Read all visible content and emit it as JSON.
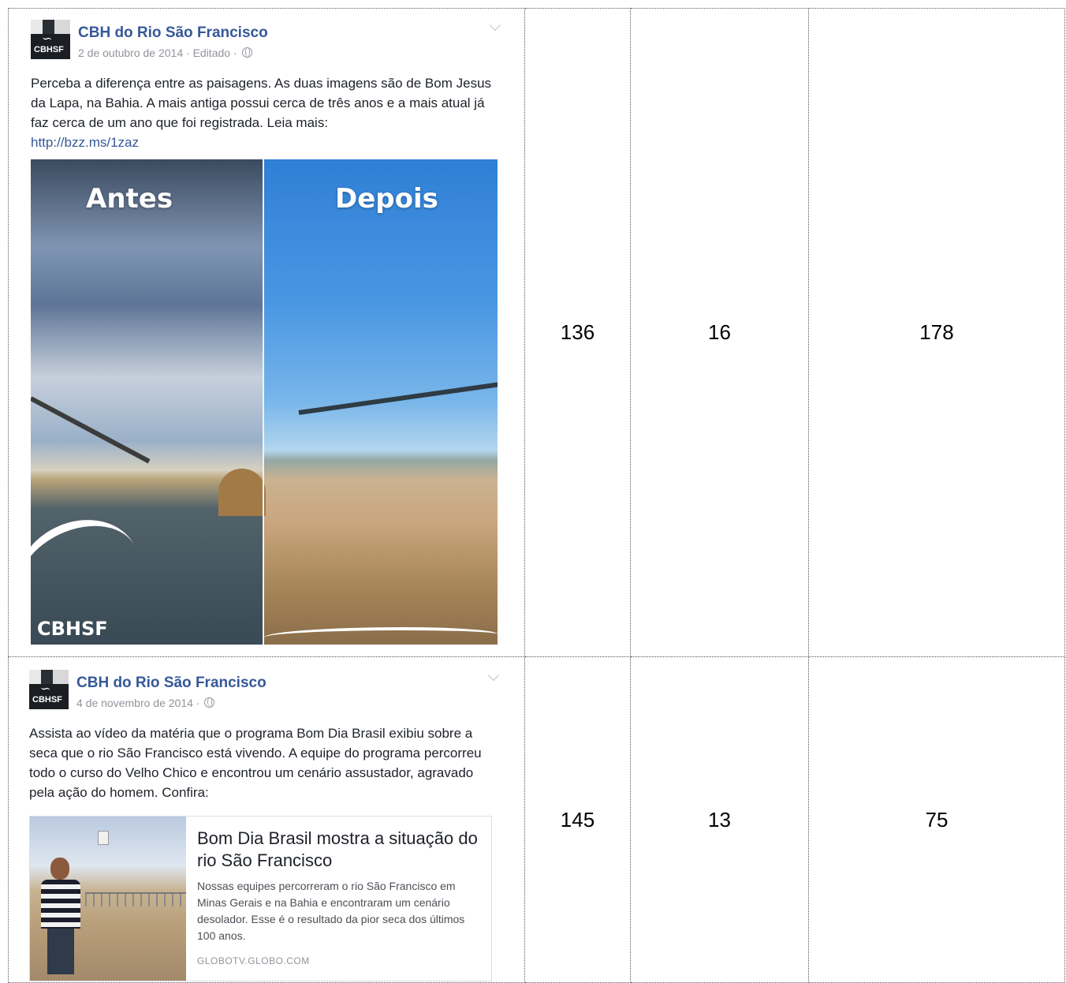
{
  "rows": [
    {
      "post": {
        "page_name": "CBH do Rio São Francisco",
        "date": "2 de outubro de 2014",
        "edited": "· Editado ·",
        "text": "Perceba a diferença entre as paisagens. As duas imagens são de Bom Jesus da Lapa, na Bahia. A mais antiga possui cerca de três anos e a mais atual já faz cerca de um ano que foi registrada. Leia mais:",
        "link": "http://bzz.ms/1zaz",
        "image": {
          "left_label": "Antes",
          "right_label": "Depois",
          "watermark": "CBHSF"
        }
      },
      "values": [
        "136",
        "16",
        "178"
      ]
    },
    {
      "post": {
        "page_name": "CBH do Rio São Francisco",
        "date": "4 de novembro de 2014",
        "edited": "·",
        "text": "Assista ao vídeo da matéria que o programa Bom Dia Brasil exibiu sobre a seca que o rio São Francisco está vivendo. A equipe do programa percorreu todo o curso do Velho Chico e encontrou um cenário assustador, agravado pela ação do homem. Confira:",
        "card": {
          "title": "Bom Dia Brasil mostra a situação do rio São Francisco",
          "description": "Nossas equipes percorreram o rio São Francisco em Minas Gerais e na Bahia e encontraram um cenário desolador. Esse é o resultado da pior seca dos últimos 100 anos.",
          "source": "GLOBOTV.GLOBO.COM"
        }
      },
      "values": [
        "145",
        "13",
        "75"
      ]
    }
  ],
  "avatar_text": "CBHSF",
  "colors": {
    "page_name": "#365899",
    "meta": "#90949c",
    "text": "#1d2129"
  }
}
